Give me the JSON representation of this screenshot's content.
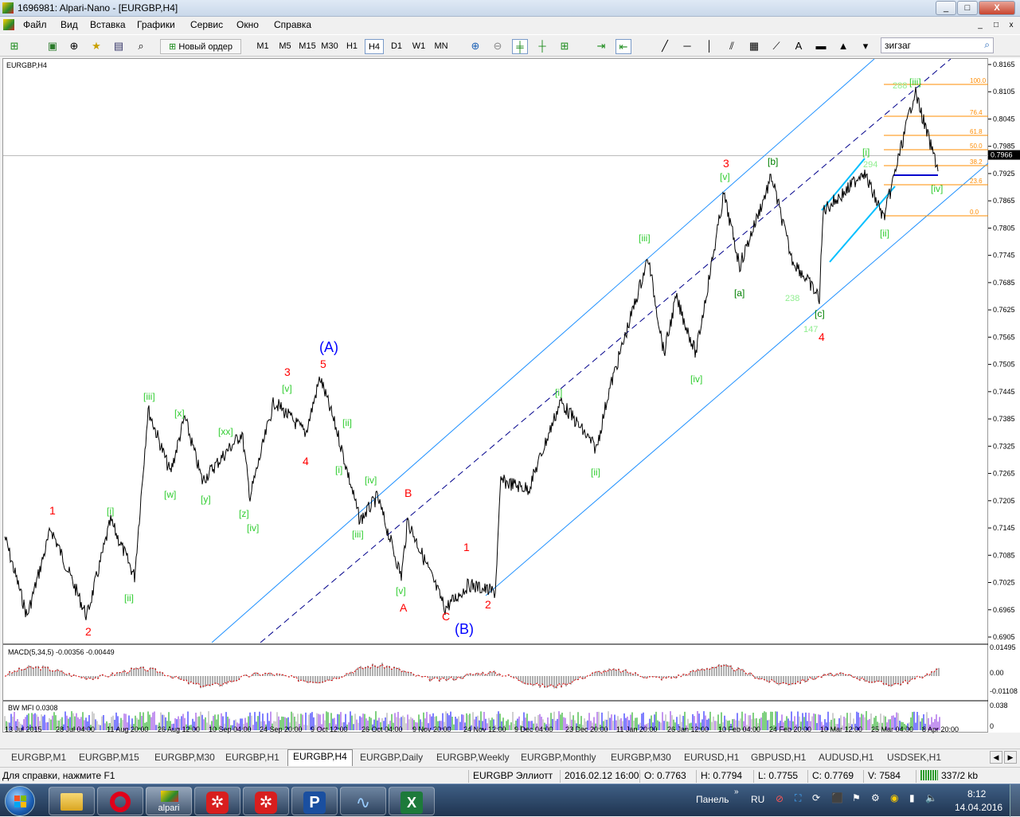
{
  "window": {
    "title": "1696981: Alpari-Nano - [EURGBP,H4]",
    "minimize": "_",
    "maximize": "□",
    "close": "X"
  },
  "menu": [
    "Файл",
    "Вид",
    "Вставка",
    "Графики",
    "Сервис",
    "Окно",
    "Справка"
  ],
  "mdi": {
    "minimize": "_",
    "restore": "□",
    "close": "x"
  },
  "toolbar": {
    "new_order": "Новый ордер",
    "timeframes": [
      "M1",
      "M5",
      "M15",
      "M30",
      "H1",
      "H4",
      "D1",
      "W1",
      "MN"
    ],
    "active_tf": "H4",
    "search_value": "зигзаг"
  },
  "chart": {
    "symbol_label": "EURGBP,H4",
    "indicator1_label": "MACD(5,34,5) -0.00356 -0.00449",
    "indicator2_label": "BW MFI 0.0308",
    "current_price": "0.7966",
    "fib_levels": [
      "100.0",
      "76.4",
      "61.8",
      "50.0",
      "38.2",
      "23.6",
      "0.0"
    ],
    "macd_scale": [
      "0.01495",
      "0.00",
      "-0.01108"
    ],
    "mfi_scale": [
      "0.038",
      "0"
    ]
  },
  "price_scale": [
    "0.8165",
    "0.8105",
    "0.8045",
    "0.7985",
    "0.7925",
    "0.7865",
    "0.7805",
    "0.7745",
    "0.7685",
    "0.7625",
    "0.7565",
    "0.7505",
    "0.7445",
    "0.7385",
    "0.7325",
    "0.7265",
    "0.7205",
    "0.7145",
    "0.7085",
    "0.7025",
    "0.6965",
    "0.6905"
  ],
  "time_scale": [
    "13 Jul 2015",
    "28 Jul 04:00",
    "11 Aug 20:00",
    "26 Aug 12:00",
    "10 Sep 04:00",
    "24 Sep 20:00",
    "9 Oct 12:00",
    "26 Oct 04:00",
    "9 Nov 20:00",
    "24 Nov 12:00",
    "9 Dec 04:00",
    "23 Dec 20:00",
    "11 Jan 20:00",
    "26 Jan 12:00",
    "10 Feb 04:00",
    "24 Feb 20:00",
    "10 Mar 12:00",
    "25 Mar 04:00",
    "8 Apr 20:00"
  ],
  "wave_labels": [
    {
      "t": "1",
      "c": "#ff0000"
    },
    {
      "t": "2",
      "c": "#ff0000"
    },
    {
      "t": "3",
      "c": "#ff0000"
    },
    {
      "t": "4",
      "c": "#ff0000"
    },
    {
      "t": "5",
      "c": "#ff0000"
    },
    {
      "t": "(A)",
      "c": "#0000ff"
    },
    {
      "t": "(B)",
      "c": "#0000ff"
    },
    {
      "t": "A",
      "c": "#ff0000"
    },
    {
      "t": "B",
      "c": "#ff0000"
    },
    {
      "t": "C",
      "c": "#ff0000"
    },
    {
      "t": "1",
      "c": "#ff0000"
    },
    {
      "t": "2",
      "c": "#ff0000"
    },
    {
      "t": "3",
      "c": "#ff0000"
    },
    {
      "t": "4",
      "c": "#ff0000"
    },
    {
      "t": "[i]",
      "c": "#32cd32"
    },
    {
      "t": "[ii]",
      "c": "#32cd32"
    },
    {
      "t": "[iii]",
      "c": "#32cd32"
    },
    {
      "t": "[w]",
      "c": "#32cd32"
    },
    {
      "t": "[x]",
      "c": "#32cd32"
    },
    {
      "t": "[y]",
      "c": "#32cd32"
    },
    {
      "t": "[xx]",
      "c": "#32cd32"
    },
    {
      "t": "[z]",
      "c": "#32cd32"
    },
    {
      "t": "[iv]",
      "c": "#32cd32"
    },
    {
      "t": "[v]",
      "c": "#32cd32"
    },
    {
      "t": "[i]",
      "c": "#32cd32"
    },
    {
      "t": "[ii]",
      "c": "#32cd32"
    },
    {
      "t": "[iii]",
      "c": "#32cd32"
    },
    {
      "t": "[iv]",
      "c": "#32cd32"
    },
    {
      "t": "[v]",
      "c": "#32cd32"
    },
    {
      "t": "[i]",
      "c": "#32cd32"
    },
    {
      "t": "[ii]",
      "c": "#32cd32"
    },
    {
      "t": "[iii]",
      "c": "#32cd32"
    },
    {
      "t": "[iv]",
      "c": "#32cd32"
    },
    {
      "t": "[v]",
      "c": "#32cd32"
    },
    {
      "t": "[a]",
      "c": "#008000"
    },
    {
      "t": "[b]",
      "c": "#008000"
    },
    {
      "t": "[c]",
      "c": "#008000"
    },
    {
      "t": "[i]",
      "c": "#32cd32"
    },
    {
      "t": "[ii]",
      "c": "#32cd32"
    },
    {
      "t": "[iii]",
      "c": "#32cd32"
    },
    {
      "t": "[iv]",
      "c": "#32cd32"
    },
    {
      "t": "238",
      "c": "#90ee90"
    },
    {
      "t": "147",
      "c": "#90ee90"
    },
    {
      "t": "294",
      "c": "#90ee90"
    },
    {
      "t": "288",
      "c": "#90ee90"
    }
  ],
  "tabs": [
    "EURGBP,M1",
    "EURGBP,M15",
    "EURGBP,M30",
    "EURGBP,H1",
    "EURGBP,H4",
    "EURGBP,Daily",
    "EURGBP,Weekly",
    "EURGBP,Monthly",
    "EURGBP,M30",
    "EURUSD,H1",
    "GBPUSD,H1",
    "AUDUSD,H1",
    "USDSEK,H1"
  ],
  "active_tab": "EURGBP,H4",
  "status": {
    "help": "Для справки, нажмите F1",
    "profile": "EURGBP Эллиотт",
    "time": "2016.02.12 16:00",
    "open": "O: 0.7763",
    "high": "H: 0.7794",
    "low": "L: 0.7755",
    "close": "C: 0.7769",
    "volume": "V: 7584",
    "traffic": "337/2 kb"
  },
  "taskbar": {
    "panel": "Панель",
    "lang": "RU",
    "time": "8:12",
    "date": "14.04.2016",
    "alpari": "alpari"
  }
}
